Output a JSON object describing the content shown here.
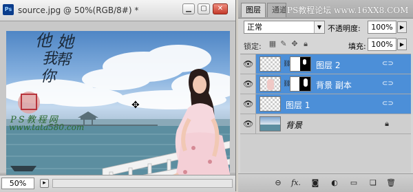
{
  "document": {
    "app_icon": "Ps",
    "title": "source.jpg @ 50%(RGB/8#) *",
    "buttons": {
      "minimize": "▁",
      "maximize": "▢",
      "close": "✕"
    },
    "status": {
      "zoom": "50%"
    },
    "photo_overlay": {
      "calligraphy": [
        "他",
        "她",
        "我",
        "帮",
        "你"
      ],
      "website_text": "PS教程网",
      "website_url": "www.tata580.com"
    }
  },
  "panel": {
    "tabs": [
      "图层",
      "通道"
    ],
    "tab_watermark": "PS教程论坛 www.16XX8.COM",
    "blend_mode": "正常",
    "opacity_label": "不透明度:",
    "opacity_value": "100%",
    "lock_label": "锁定:",
    "fill_label": "填充:",
    "fill_value": "100%",
    "layers": [
      {
        "name": "图层 2",
        "selected": true,
        "has_mask": true,
        "thumb": "transparent"
      },
      {
        "name": "背景 副本",
        "selected": true,
        "has_mask": true,
        "thumb": "photo"
      },
      {
        "name": "图层 1",
        "selected": true,
        "has_mask": false,
        "thumb": "transparent"
      },
      {
        "name": "背景",
        "selected": false,
        "has_mask": false,
        "thumb": "photo"
      }
    ]
  },
  "colors": {
    "selection": "#4c8fd8",
    "close_button": "#c43a2a"
  },
  "icons": {
    "visibility": "eye-icon",
    "chain": "link-icon",
    "lock": "lock-icon",
    "bottom_bar": [
      "link-layers-icon",
      "fx-icon",
      "add-mask-icon",
      "adjustment-icon",
      "new-group-icon",
      "new-layer-icon",
      "delete-icon"
    ]
  }
}
